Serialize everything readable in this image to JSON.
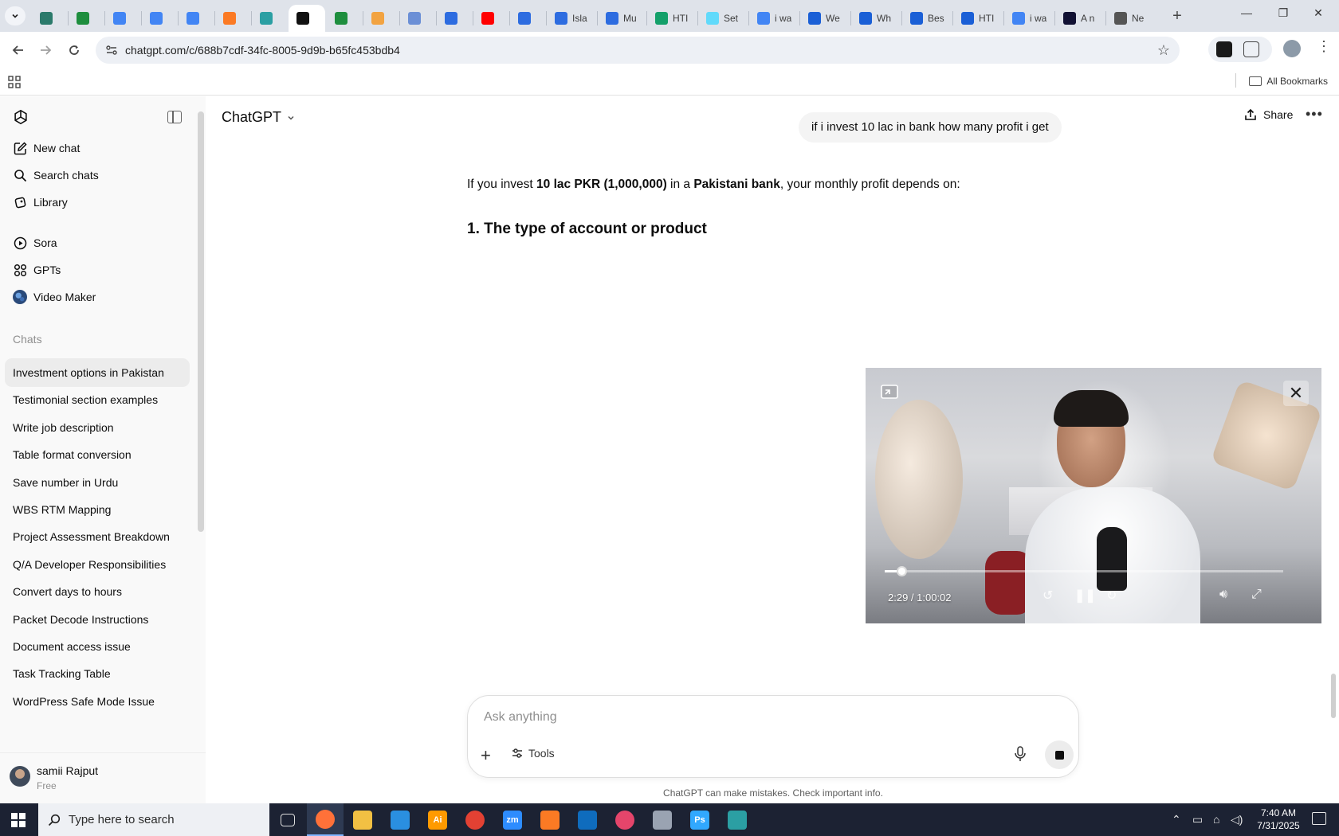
{
  "browser": {
    "tabs": [
      {
        "label": "",
        "icon": "shield-favicon",
        "color": "#2b7a6b"
      },
      {
        "label": "",
        "icon": "sheets-favicon",
        "color": "#1e8e3e"
      },
      {
        "label": "",
        "icon": "docs-favicon",
        "color": "#4285f4"
      },
      {
        "label": "",
        "icon": "docs-favicon",
        "color": "#4285f4"
      },
      {
        "label": "",
        "icon": "docs-favicon",
        "color": "#4285f4"
      },
      {
        "label": "",
        "icon": "xampp-favicon",
        "color": "#fb7a24"
      },
      {
        "label": "",
        "icon": "diamond-favicon",
        "color": "#2b9fa3"
      },
      {
        "label": "",
        "icon": "chatgpt-favicon",
        "color": "#111111",
        "active": true
      },
      {
        "label": "",
        "icon": "sheets-favicon",
        "color": "#1e8e3e"
      },
      {
        "label": "",
        "icon": "hand-favicon",
        "color": "#f2a341"
      },
      {
        "label": "",
        "icon": "grid-favicon",
        "color": "#6b8fd6"
      },
      {
        "label": "",
        "icon": "forms-favicon",
        "color": "#2d6ce0"
      },
      {
        "label": "",
        "icon": "youtube-favicon",
        "color": "#ff0000"
      },
      {
        "label": "",
        "icon": "forms-favicon",
        "color": "#2d6ce0"
      },
      {
        "label": "Isla",
        "icon": "forms-favicon",
        "color": "#2d6ce0"
      },
      {
        "label": "Mu",
        "icon": "forms-favicon",
        "color": "#2d6ce0"
      },
      {
        "label": "HTI",
        "icon": "w-favicon",
        "color": "#14a06a"
      },
      {
        "label": "Set",
        "icon": "react-favicon",
        "color": "#61dafb"
      },
      {
        "label": "i wa",
        "icon": "google-favicon",
        "color": "#4285f4"
      },
      {
        "label": "We",
        "icon": "c-favicon",
        "color": "#1a5fd6"
      },
      {
        "label": "Wh",
        "icon": "c-favicon",
        "color": "#1a5fd6"
      },
      {
        "label": "Bes",
        "icon": "c-favicon",
        "color": "#1a5fd6"
      },
      {
        "label": "HTI",
        "icon": "c-favicon",
        "color": "#1a5fd6"
      },
      {
        "label": "i wa",
        "icon": "google-favicon",
        "color": "#4285f4"
      },
      {
        "label": "A n",
        "icon": "ai-favicon",
        "color": "#111133"
      },
      {
        "label": "Ne",
        "icon": "chrome-favicon",
        "color": "#555555"
      }
    ],
    "url": "chatgpt.com/c/688b7cdf-34fc-8005-9d9b-b65fc453bdb4",
    "all_bookmarks": "All Bookmarks",
    "new_tab_symbol": "+",
    "window_controls": {
      "minimize": "—",
      "restore": "❐",
      "close": "✕"
    }
  },
  "sidebar": {
    "primary": [
      {
        "label": "New chat",
        "icon": "new-chat-icon"
      },
      {
        "label": "Search chats",
        "icon": "search-icon"
      },
      {
        "label": "Library",
        "icon": "library-icon"
      }
    ],
    "secondary": [
      {
        "label": "Sora",
        "icon": "sora-icon"
      },
      {
        "label": "GPTs",
        "icon": "gpts-icon"
      },
      {
        "label": "Video Maker",
        "icon": "video-maker-avatar-icon"
      }
    ],
    "chats_heading": "Chats",
    "chats": [
      {
        "label": "Investment options in Pakistan",
        "active": true
      },
      {
        "label": "Testimonial section examples"
      },
      {
        "label": "Write job description"
      },
      {
        "label": "Table format conversion"
      },
      {
        "label": "Save number in Urdu"
      },
      {
        "label": "WBS RTM Mapping"
      },
      {
        "label": "Project Assessment Breakdown"
      },
      {
        "label": "Q/A Developer Responsibilities"
      },
      {
        "label": "Convert days to hours"
      },
      {
        "label": "Packet Decode Instructions"
      },
      {
        "label": "Document access issue"
      },
      {
        "label": "Task Tracking Table"
      },
      {
        "label": "WordPress Safe Mode Issue"
      }
    ],
    "user": {
      "name": "samii Rajput",
      "plan": "Free"
    }
  },
  "header": {
    "model": "ChatGPT",
    "share": "Share"
  },
  "conversation": {
    "user_message": "if i invest 10 lac in bank how many profit i get",
    "answer_parts": [
      {
        "text": "If you invest ",
        "bold": false
      },
      {
        "text": "10 lac PKR (1,000,000)",
        "bold": true
      },
      {
        "text": " in a ",
        "bold": false
      },
      {
        "text": "Pakistani bank",
        "bold": true
      },
      {
        "text": ", your monthly profit depends on:",
        "bold": false
      }
    ],
    "heading": "1. The type of account or product"
  },
  "composer": {
    "placeholder": "Ask anything",
    "tools": "Tools",
    "disclaimer": "ChatGPT can make mistakes. Check important info."
  },
  "video": {
    "time": "2:29 / 1:00:02",
    "progress": 0.0414
  },
  "taskbar": {
    "search_placeholder": "Type here to search",
    "time": "7:40 AM",
    "date": "7/31/2025",
    "apps": [
      {
        "icon": "task-view-icon",
        "color": "#1c2233"
      },
      {
        "icon": "firefox-icon",
        "color": "#ff7139",
        "active": true
      },
      {
        "icon": "file-explorer-icon",
        "color": "#f2c043"
      },
      {
        "icon": "vscode-icon",
        "color": "#2a8fe0"
      },
      {
        "icon": "illustrator-icon",
        "color": "#ff9a00"
      },
      {
        "icon": "chrome-icon",
        "color": "#e34133"
      },
      {
        "icon": "zoom-icon",
        "color": "#2d8cff"
      },
      {
        "icon": "xampp-icon",
        "color": "#fb7a24"
      },
      {
        "icon": "outlook-icon",
        "color": "#0f6cbd"
      },
      {
        "icon": "creative-cloud-icon",
        "color": "#e5456b"
      },
      {
        "icon": "pen-icon",
        "color": "#9aa3b2"
      },
      {
        "icon": "photoshop-icon",
        "color": "#31a8ff"
      },
      {
        "icon": "diamond-app-icon",
        "color": "#2b9fa3"
      }
    ]
  }
}
